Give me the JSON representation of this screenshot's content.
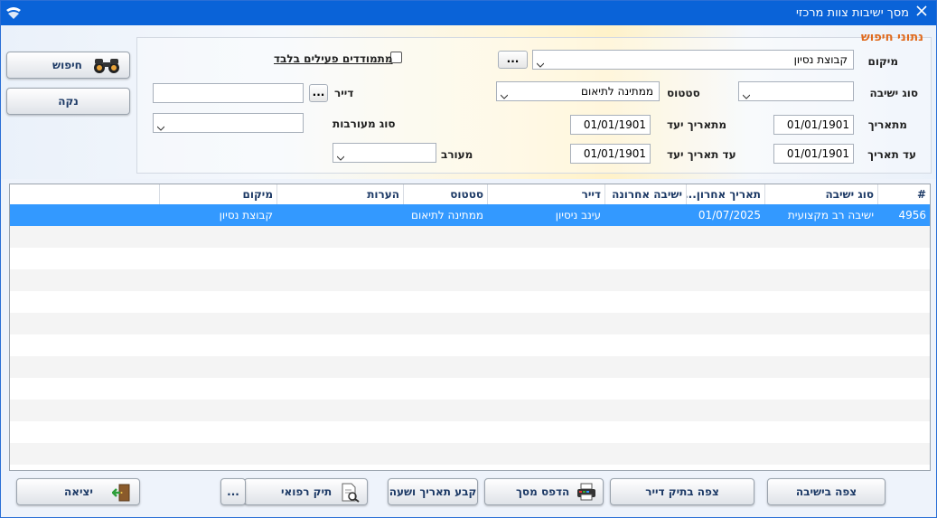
{
  "window": {
    "title": "מסך ישיבות צוות מרכזי",
    "close_icon": "close-icon",
    "logo_icon": "app-logo-icon"
  },
  "search": {
    "legend": "נתוני חיפוש",
    "location_label": "מיקום",
    "location_value": "קבוצת נסיון",
    "active_only_label": "מתמודדים פעילים בלבד",
    "active_only_checked": false,
    "meeting_type_label": "סוג ישיבה",
    "meeting_type_value": "",
    "status_label": "סטטוס",
    "status_value": "ממתינה לתיאום",
    "resident_label": "דייר",
    "resident_value": "",
    "from_date_label": "מתאריך",
    "from_date_value": "01/01/1901",
    "from_due_label": "מתאריך יעד",
    "from_due_value": "01/01/1901",
    "alert_type_label": "סוג מעורבות",
    "alert_type_value": "",
    "to_date_label": "עד תאריך",
    "to_date_value": "01/01/1901",
    "to_due_label": "עד תאריך יעד",
    "to_due_value": "01/01/1901",
    "involved_label": "מעורב",
    "involved_value": "",
    "dots": "..."
  },
  "side_buttons": {
    "search_label": "חיפוש",
    "clear_label": "נקה"
  },
  "grid": {
    "columns": [
      "#",
      "סוג ישיבה",
      "תאריך אחרון...",
      "ישיבה אחרונה",
      "דייר",
      "סטטוס",
      "הערות",
      "מיקום"
    ],
    "rows": [
      {
        "num": "4956",
        "type": "ישיבה רב מקצועית",
        "last_date": "01/07/2025",
        "last_meeting": "",
        "resident": "עינב ניסיון",
        "status": "ממתינה לתיאום",
        "notes": "",
        "location": "קבוצת נסיון"
      }
    ]
  },
  "bottom_buttons": {
    "view_meeting": "צפה בישיבה",
    "view_resident_file": "צפה בתיק דייר",
    "print_screen": "הדפס מסך",
    "set_datetime": "קבע תאריך ושעה",
    "medical_file": "תיק רפואי",
    "more": "...",
    "exit": "יציאה"
  },
  "colors": {
    "titlebar": "#0a63d8",
    "selection": "#3399ff",
    "legend": "#e06a1c",
    "header_text": "#1d3a66"
  }
}
